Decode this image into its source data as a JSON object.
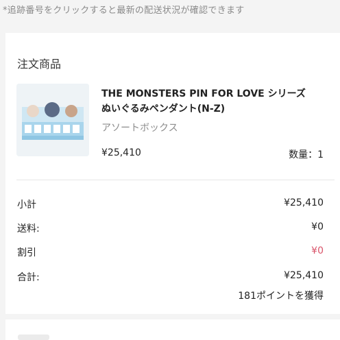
{
  "notice": "*追跡番号をクリックすると最新の配送状況が確認できます",
  "order": {
    "section_title": "注文商品",
    "product": {
      "name_en": "THE MONSTERS PIN FOR LOVE シリーズ",
      "name_jp": "ぬいぐるみペンダント(N-Z)",
      "variant": "アソートボックス",
      "price": "¥25,410",
      "quantity": "数量：1"
    }
  },
  "summary": {
    "subtotal_label": "小計",
    "subtotal_value": "¥25,410",
    "shipping_label": "送料:",
    "shipping_value": "¥0",
    "discount_label": "割引",
    "discount_value": "¥0",
    "total_label": "合計:",
    "total_value": "¥25,410",
    "points": "181ポイントを獲得"
  },
  "colors": {
    "discount": "#d9546a",
    "muted": "#8c8c8c"
  }
}
